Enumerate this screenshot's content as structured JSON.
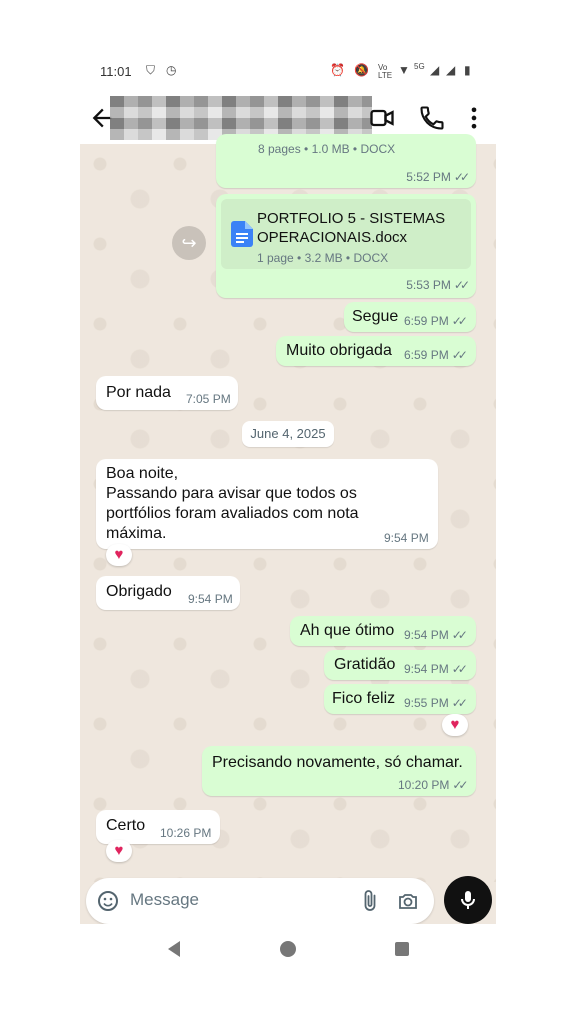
{
  "status": {
    "time": "11:01",
    "network_label": "Vo LTE",
    "signal": "5G"
  },
  "chat": {
    "partial_doc_meta": "8 pages • 1.0 MB • DOCX",
    "partial_doc_time": "5:52 PM",
    "doc": {
      "title": "PORTFOLIO 5 - SISTEMAS OPERACIONAIS.docx",
      "meta": "1 page • 3.2 MB • DOCX",
      "time": "5:53 PM"
    },
    "messages": [
      {
        "text": "Segue",
        "time": "6:59 PM"
      },
      {
        "text": "Muito obrigada",
        "time": "6:59 PM"
      },
      {
        "text": "Por nada",
        "time": "7:05 PM"
      },
      {
        "text": "Boa noite,\nPassando para avisar que todos os\nportfólios foram avaliados com nota\nmáxima.",
        "time": "9:54 PM"
      },
      {
        "text": "Obrigado",
        "time": "9:54 PM"
      },
      {
        "text": "Ah que ótimo",
        "time": "9:54 PM"
      },
      {
        "text": "Gratidão",
        "time": "9:54 PM"
      },
      {
        "text": "Fico feliz",
        "time": "9:55 PM"
      },
      {
        "text": "Precisando novamente, só chamar.",
        "time": "10:20 PM"
      },
      {
        "text": "Certo",
        "time": "10:26 PM"
      }
    ],
    "date_separator": "June 4, 2025"
  },
  "composer": {
    "placeholder": "Message"
  },
  "colors": {
    "outgoing": "#d9fdd3",
    "incoming": "#ffffff",
    "heart": "#e0245e"
  }
}
